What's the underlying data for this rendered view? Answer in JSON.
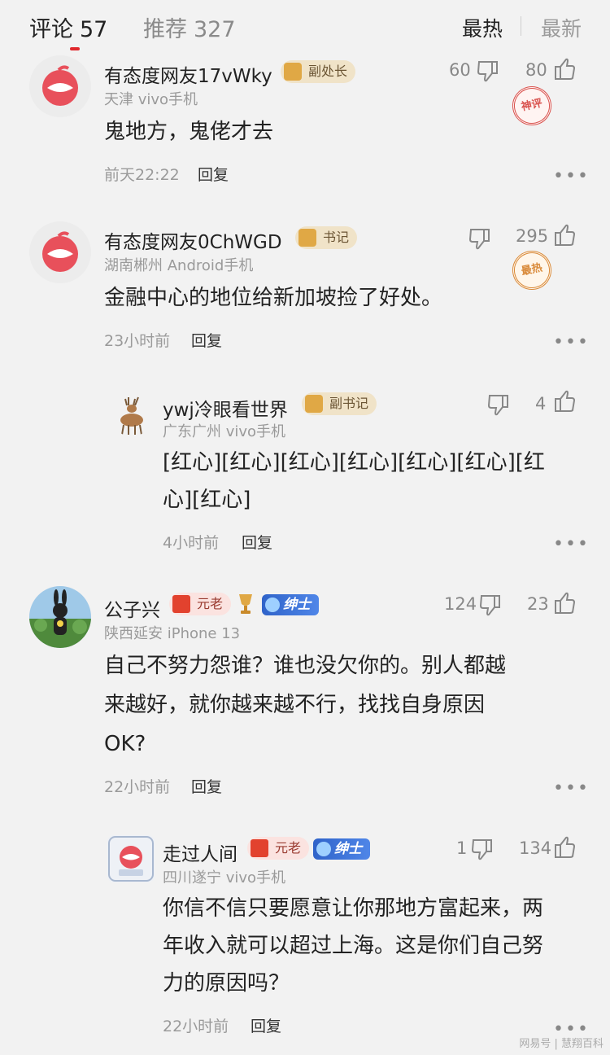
{
  "header": {
    "tabs": [
      {
        "label": "评论",
        "count": "57"
      },
      {
        "label": "推荐",
        "count": "327"
      }
    ],
    "sort": {
      "hot": "最热",
      "new": "最新"
    }
  },
  "comments": [
    {
      "username": "有态度网友17vWky",
      "badge": "副处长",
      "location": "天津 vivo手机",
      "text": "鬼地方，鬼佬才去",
      "time": "前天22:22",
      "reply": "回复",
      "dislikes": "60",
      "likes": "80",
      "stamp": "神评"
    },
    {
      "username": "有态度网友0ChWGD",
      "badge": "书记",
      "location": "湖南郴州 Android手机",
      "text": "金融中心的地位给新加坡捡了好处。",
      "time": "23小时前",
      "reply": "回复",
      "likes": "295",
      "stamp": "最热"
    },
    {
      "username": "ywj冷眼看世界",
      "badge": "副书记",
      "location": "广东广州 vivo手机",
      "text_line1": "[红心][红心][红心][红心][红心][红心][红",
      "text_line2": "心][红心]",
      "time": "4小时前",
      "reply": "回复",
      "likes": "4"
    },
    {
      "username": "公子兴",
      "badge": "元老",
      "badge2": "绅士",
      "location": "陕西延安 iPhone 13",
      "text_line1": "自己不努力怨谁？谁也没欠你的。别人都越",
      "text_line2": "来越好，就你越来越不行，找找自身原因",
      "text_line3": "OK?",
      "time": "22小时前",
      "reply": "回复",
      "dislikes": "124",
      "likes": "23"
    },
    {
      "username": "走过人间",
      "badge": "元老",
      "badge2": "绅士",
      "location": "四川遂宁 vivo手机",
      "text_line1": "你信不信只要愿意让你那地方富起来，两",
      "text_line2": "年收入就可以超过上海。这是你们自己努",
      "text_line3": "力的原因吗？",
      "time": "22小时前",
      "reply": "回复",
      "dislikes": "1",
      "likes": "134"
    }
  ],
  "more_label": "•••",
  "watermark": "网易号 | 慧翔百科",
  "colors": {
    "accent": "#e0282c",
    "background": "#f2f2f2",
    "muted": "#9a9a9a"
  }
}
